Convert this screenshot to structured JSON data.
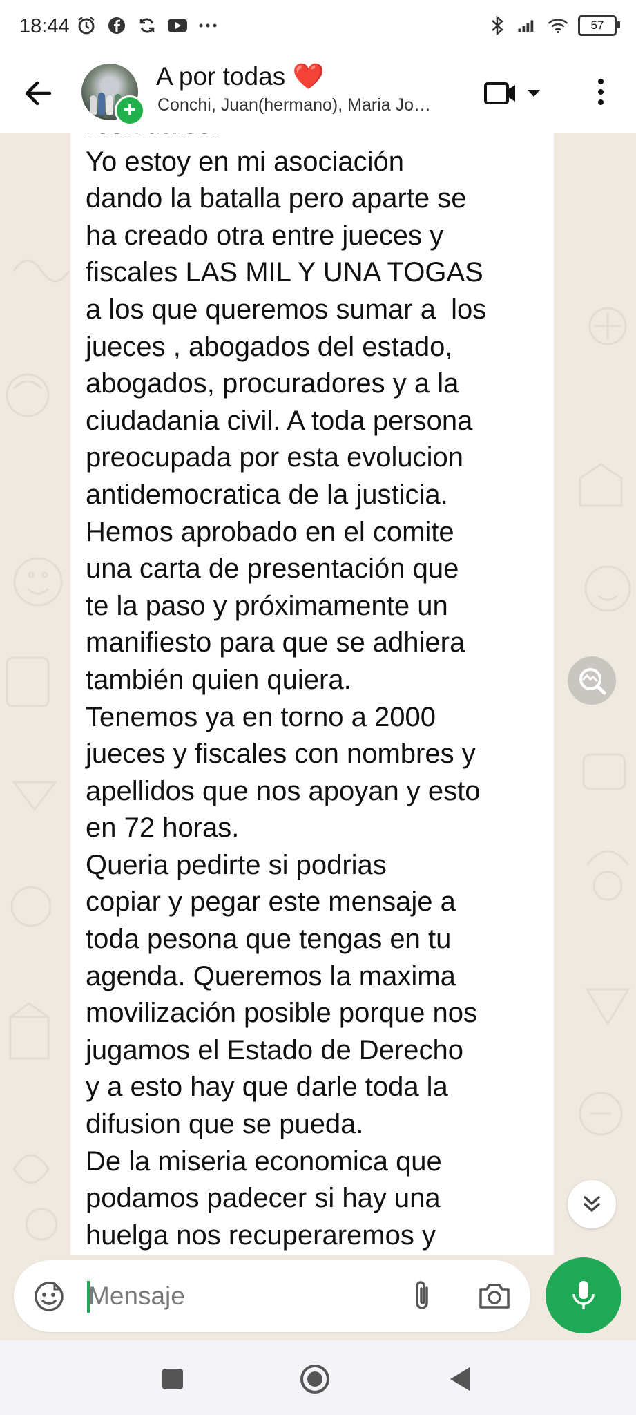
{
  "status_bar": {
    "time": "18:44",
    "battery": "57",
    "left_icons": [
      "alarm-icon",
      "facebook-icon",
      "sync-icon",
      "youtube-icon",
      "more-notifications-icon"
    ],
    "right_icons": [
      "bluetooth-icon",
      "signal-icon",
      "wifi-icon",
      "battery-icon"
    ]
  },
  "header": {
    "title": "A por todas",
    "title_emoji": "❤️",
    "subtitle": "Conchi, Juan(hermano), Maria Jo…",
    "back_icon": "arrow-left-icon",
    "video_icon": "video-call-icon",
    "dropdown_icon": "caret-down-icon",
    "more_icon": "more-vertical-icon"
  },
  "message": {
    "text": "residuales.\nYo estoy en mi asociación\ndando la batalla pero aparte se\nha creado otra entre jueces y\nfiscales LAS MIL Y UNA TOGAS\na los que queremos sumar a  los\njueces , abogados del estado,\nabogados, procuradores y a la\nciudadania civil. A toda persona\npreocupada por esta evolucion\nantidemocratica de la justicia.\nHemos aprobado en el comite\nuna carta de presentación que\nte la paso y próximamente un\nmanifiesto para que se adhiera\ntambién quien quiera.\nTenemos ya en torno a 2000\njueces y fiscales con nombres y\napellidos que nos apoyan y esto\nen 72 horas.\nQueria pedirte si podrias\ncopiar y pegar este mensaje a\ntoda pesona que tengas en tu\nagenda. Queremos la maxima\nmovilización posible porque nos\njugamos el Estado de Derecho\ny a esto hay que darle toda la\ndifusion que se pueda.\nDe la miseria economica que\npodamos padecer si hay una\nhuelga nos recuperaremos y"
  },
  "composer": {
    "placeholder": "Mensaje",
    "value": ""
  },
  "colors": {
    "accent": "#1fa855",
    "chat_background": "#efe9df",
    "bubble": "#ffffff"
  }
}
